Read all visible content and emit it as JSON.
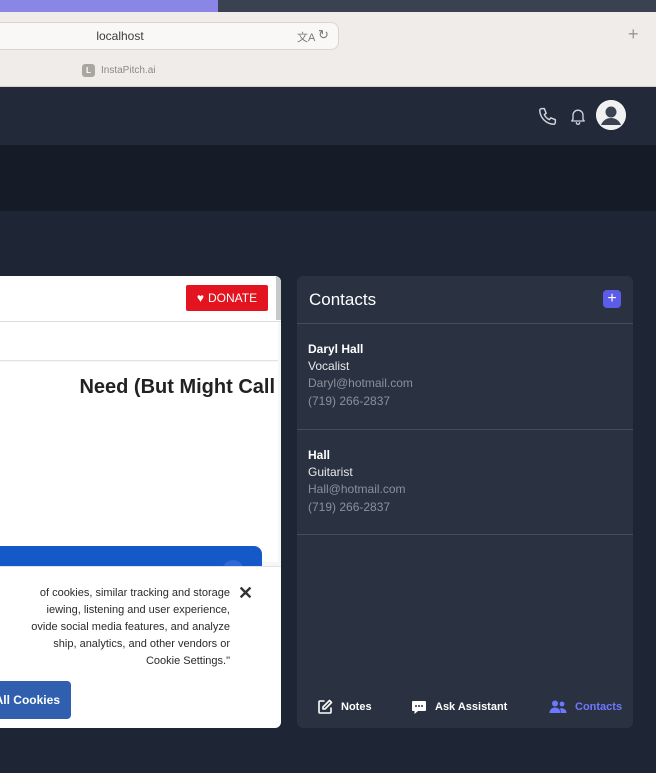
{
  "browser": {
    "url": "localhost",
    "tab_title": "InstaPitch.ai",
    "tab_favicon_letter": "L",
    "new_tab": "+"
  },
  "header": {
    "icons": [
      "phone-icon",
      "bell-icon",
      "avatar"
    ]
  },
  "article": {
    "donate_label": "DONATE",
    "headline": "Need (But Might Call"
  },
  "cookie_banner": {
    "lines": [
      "of cookies, similar tracking and storage",
      "iewing, listening and user experience,",
      "ovide social media features, and analyze",
      "ship, analytics, and other vendors or",
      "Cookie Settings.\""
    ],
    "accept_label": "All Cookies",
    "close": "✕"
  },
  "contacts": {
    "title": "Contacts",
    "add_label": "+",
    "items": [
      {
        "name": "Daryl Hall",
        "role": "Vocalist",
        "email": "Daryl@hotmail.com",
        "phone": "(719) 266-2837"
      },
      {
        "name": "Hall",
        "role": "Guitarist",
        "email": "Hall@hotmail.com",
        "phone": "(719) 266-2837"
      }
    ],
    "nav": {
      "notes": "Notes",
      "assistant": "Ask Assistant",
      "contacts": "Contacts"
    }
  },
  "colors": {
    "accent": "#5b5de8",
    "donate": "#e3141f",
    "cookie_button": "#2f5fae",
    "active_nav": "#6e78ff"
  }
}
